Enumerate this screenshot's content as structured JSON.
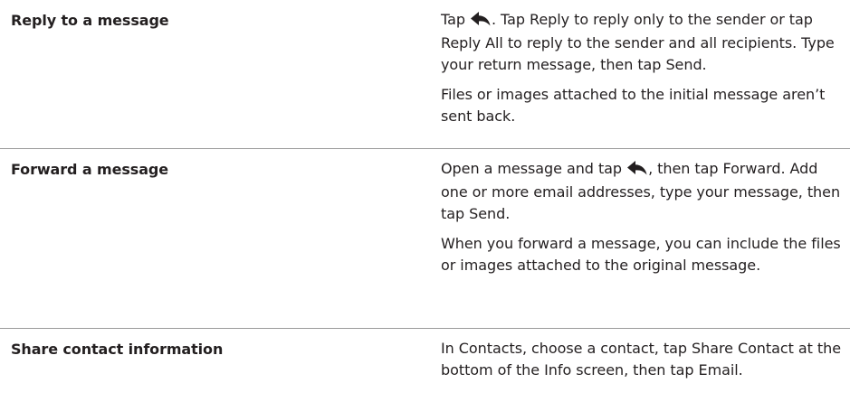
{
  "rows": [
    {
      "task": "Reply to a message",
      "p1_before": "Tap ",
      "p1_after": ". Tap Reply to reply only to the sender or tap Reply All to reply to the sender and all recipients. Type your return message, then tap Send.",
      "p2": "Files or images attached to the initial message aren’t sent back."
    },
    {
      "task": "Forward a message",
      "p1_before": "Open a message and tap ",
      "p1_after": ", then tap Forward. Add one or more email addresses, type your message, then tap Send.",
      "p2": "When you forward a message, you can include the files or images attached to the original message."
    },
    {
      "task": "Share contact information",
      "p1": "In Contacts, choose a contact, tap Share Contact at the bottom of the Info screen, then tap Email."
    }
  ],
  "icons": {
    "reply": "reply-arrow-icon"
  }
}
